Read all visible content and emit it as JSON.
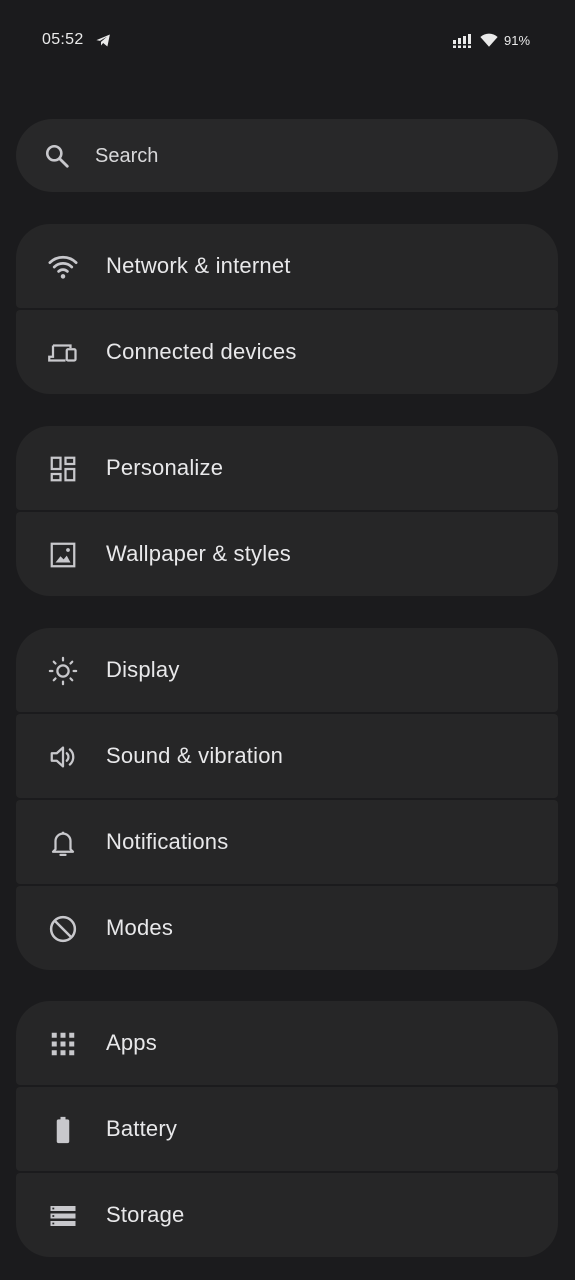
{
  "status_bar": {
    "time": "05:52",
    "battery": "91%"
  },
  "search": {
    "label": "Search"
  },
  "groups": [
    {
      "items": [
        {
          "label": "Network & internet",
          "icon": "wifi-icon"
        },
        {
          "label": "Connected devices",
          "icon": "devices-icon"
        }
      ]
    },
    {
      "items": [
        {
          "label": "Personalize",
          "icon": "dashboard-icon"
        },
        {
          "label": "Wallpaper & styles",
          "icon": "wallpaper-icon"
        }
      ]
    },
    {
      "items": [
        {
          "label": "Display",
          "icon": "brightness-icon"
        },
        {
          "label": "Sound & vibration",
          "icon": "volume-icon"
        },
        {
          "label": "Notifications",
          "icon": "bell-icon"
        },
        {
          "label": "Modes",
          "icon": "do-not-disturb-icon"
        }
      ]
    },
    {
      "items": [
        {
          "label": "Apps",
          "icon": "apps-grid-icon"
        },
        {
          "label": "Battery",
          "icon": "battery-icon"
        },
        {
          "label": "Storage",
          "icon": "storage-icon"
        }
      ]
    }
  ],
  "colors": {
    "background": "#1b1b1d",
    "card": "#262627",
    "search_bar": "#282829",
    "text": "#e8e8ea",
    "icon": "#c8c8cc"
  }
}
